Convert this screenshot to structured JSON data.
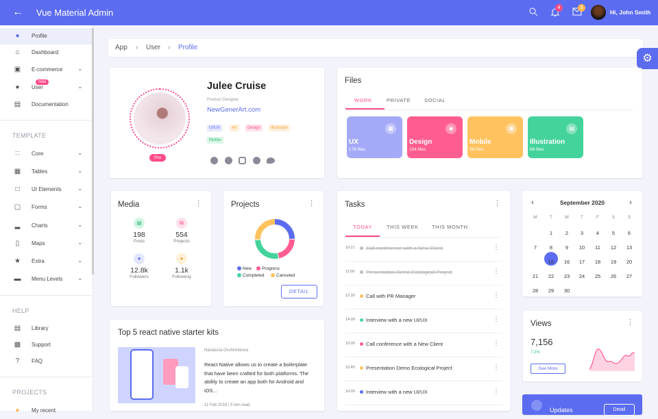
{
  "header": {
    "title": "Vue Material Admin",
    "greeting": "Hi, John Smith",
    "notif_count": "4",
    "mail_count": "3"
  },
  "sidebar": {
    "items": [
      {
        "label": "Profile"
      },
      {
        "label": "Dashboard"
      },
      {
        "label": "E-commerce"
      },
      {
        "label": "User",
        "badge": "new"
      },
      {
        "label": "Documentation"
      }
    ],
    "template_title": "TEMPLATE",
    "template_items": [
      {
        "label": "Core"
      },
      {
        "label": "Tables"
      },
      {
        "label": "UI Elements"
      },
      {
        "label": "Forms"
      },
      {
        "label": "Charts"
      },
      {
        "label": "Maps"
      },
      {
        "label": "Extra"
      },
      {
        "label": "Menu Levels"
      }
    ],
    "help_title": "HELP",
    "help_items": [
      {
        "label": "Library"
      },
      {
        "label": "Support"
      },
      {
        "label": "FAQ"
      }
    ],
    "projects_title": "PROJECTS",
    "project_items": [
      {
        "label": "My recent"
      }
    ]
  },
  "breadcrumb": [
    "App",
    "User",
    "Profile"
  ],
  "profile": {
    "name": "Julee Cruise",
    "role": "Product Designer",
    "site": "NewGenerArt.com",
    "badge": "Pro",
    "tags": [
      "UI/UX",
      "Art",
      "Design",
      "Illustrator",
      "Mobile"
    ]
  },
  "files": {
    "title": "Files",
    "tabs": [
      "WORK",
      "PRIVATE",
      "SOCIAL"
    ],
    "folders": [
      {
        "name": "UX",
        "count": "178 files",
        "color": "#a4aaf7"
      },
      {
        "name": "Design",
        "count": "154 files",
        "color": "#ff5d8f"
      },
      {
        "name": "Mobile",
        "count": "98 files",
        "color": "#ffc25f"
      },
      {
        "name": "Illustration",
        "count": "68 files",
        "color": "#44d39b"
      }
    ]
  },
  "media": {
    "title": "Media",
    "stats": [
      {
        "value": "198",
        "label": "Posts"
      },
      {
        "value": "554",
        "label": "Projects"
      },
      {
        "value": "12.8k",
        "label": "Followers"
      },
      {
        "value": "1.1k",
        "label": "Following"
      }
    ]
  },
  "projects": {
    "title": "Projects",
    "legend": [
      "New",
      "Progress",
      "Completed",
      "Canceled"
    ],
    "button": "DETAIL"
  },
  "tasks": {
    "title": "Tasks",
    "tabs": [
      "TODAY",
      "THIS WEEK",
      "THIS MONTH"
    ],
    "items": [
      {
        "time": "10:21",
        "text": "Call conference with a New Client",
        "done": true
      },
      {
        "time": "11:00",
        "text": "Presentation Demo Ecological Project",
        "done": true
      },
      {
        "time": "12:30",
        "text": "Call with PR Manager",
        "done": false
      },
      {
        "time": "14:00",
        "text": "Interview with a new UI/UX",
        "done": false
      },
      {
        "time": "15:00",
        "text": "Call conference with a New Client",
        "done": false
      },
      {
        "time": "15:45",
        "text": "Presentation Demo Ecological Project",
        "done": false
      },
      {
        "time": "16:00",
        "text": "Interview with a new UI/UX",
        "done": false
      }
    ]
  },
  "calendar": {
    "title": "September 2020",
    "days": [
      "M",
      "T",
      "W",
      "T",
      "F",
      "S",
      "S"
    ],
    "selected": "14"
  },
  "views": {
    "title": "Views",
    "value": "7,156",
    "change": "7.2%",
    "button": "See More"
  },
  "post": {
    "title": "Top 5 react native starter kits",
    "author": "Nastassia Ovchinnikova",
    "text": "React Native allows us to create a boilerplate that have been crafted for both platforms. The ability to create an app both for Android and iOS...",
    "meta": "11 Feb 2019 | 5 min read"
  },
  "updates": {
    "title": "Updates",
    "button": "Detail"
  }
}
